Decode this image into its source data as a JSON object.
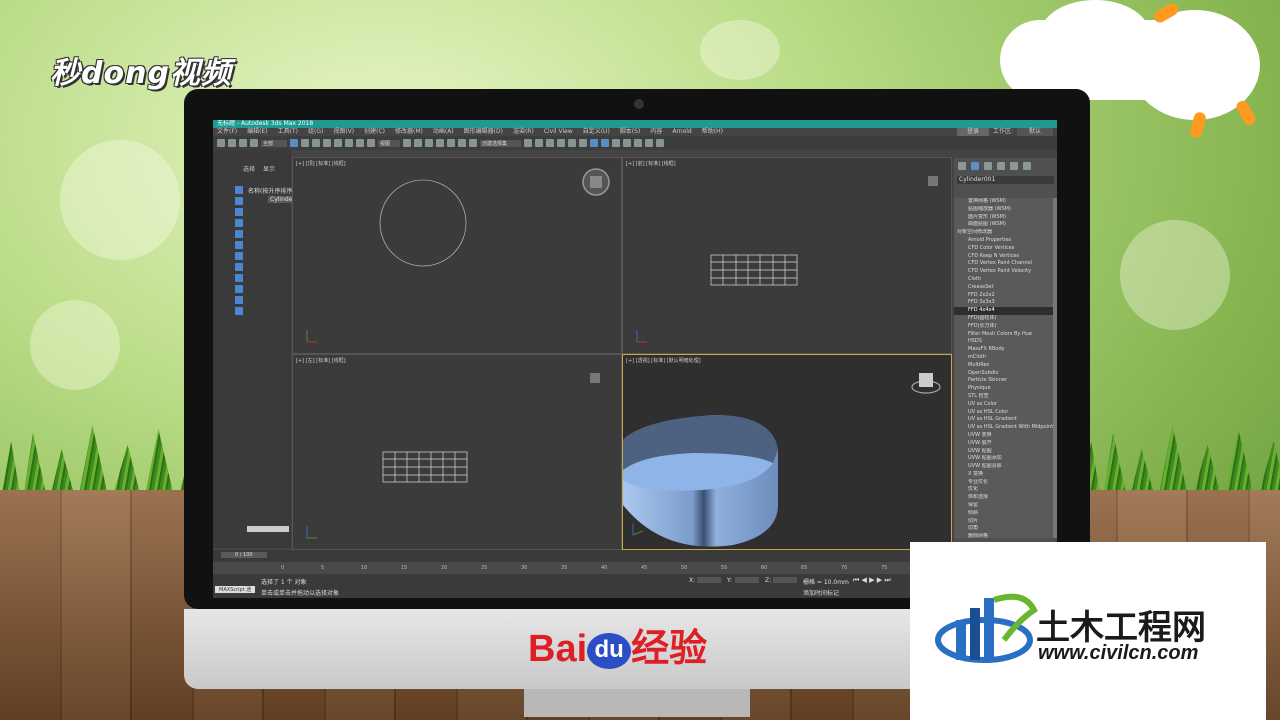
{
  "watermarks": {
    "top_logo": "秒dong视频",
    "baidu": {
      "bai": "Bai",
      "du": "du",
      "jingyan": "经验"
    },
    "civilcn": {
      "title": "土木工程网",
      "url": "www.civilcn.com"
    }
  },
  "app": {
    "title": "无标题 - Autodesk 3ds Max 2018",
    "menu": [
      "文件(F)",
      "编辑(E)",
      "工具(T)",
      "组(G)",
      "视图(V)",
      "创建(C)",
      "修改器(M)",
      "动画(A)",
      "图形编辑器(D)",
      "渲染(R)",
      "Civil View",
      "自定义(U)",
      "脚本(S)",
      "内容",
      "Arnold",
      "帮助(H)"
    ],
    "workspace_label": "工作区:",
    "workspace_value": "默认",
    "login": "登录",
    "selection_filter": "全部",
    "view_dropdown": "视图",
    "selection_set": "创建选择集"
  },
  "scene_explorer": {
    "tabs": [
      "选择",
      "显示"
    ],
    "column_header": "名称(按升序排序)",
    "item": "Cylinder"
  },
  "viewports": [
    {
      "label": "[+] [顶] [标准] [线框]"
    },
    {
      "label": "[+] [前] [标准] [线框]"
    },
    {
      "label": "[+] [左] [标准] [线框]"
    },
    {
      "label": "[+] [透视] [标准] [默认明暗处理]"
    }
  ],
  "command_panel": {
    "object_name": "Cylinder001",
    "items": [
      {
        "text": "置换网格 (WSM)",
        "type": "item"
      },
      {
        "text": "贴图缩放器 (WSM)",
        "type": "item"
      },
      {
        "text": "面片变形 (WSM)",
        "type": "item"
      },
      {
        "text": "曲面贴图 (WSM)",
        "type": "item"
      },
      {
        "text": "对象空间修改器",
        "type": "cat"
      },
      {
        "text": "Arnold Properties",
        "type": "item"
      },
      {
        "text": "CFD Color Vertices",
        "type": "item"
      },
      {
        "text": "CFD Keep N Vertices",
        "type": "item"
      },
      {
        "text": "CFD Vertex Paint Channel",
        "type": "item"
      },
      {
        "text": "CFD Vertex Paint Velocity",
        "type": "item"
      },
      {
        "text": "Cloth",
        "type": "item"
      },
      {
        "text": "CreaseSet",
        "type": "item"
      },
      {
        "text": "FFD 2x2x2",
        "type": "item"
      },
      {
        "text": "FFD 3x3x3",
        "type": "item"
      },
      {
        "text": "FFD 4x4x4",
        "type": "sel"
      },
      {
        "text": "FFD(圆柱体)",
        "type": "item"
      },
      {
        "text": "FFD(长方体)",
        "type": "item"
      },
      {
        "text": "Filter Mesh Colors By Hue",
        "type": "item"
      },
      {
        "text": "HSDS",
        "type": "item"
      },
      {
        "text": "MassFX RBody",
        "type": "item"
      },
      {
        "text": "mCloth",
        "type": "item"
      },
      {
        "text": "MultiRes",
        "type": "item"
      },
      {
        "text": "OpenSubdiv",
        "type": "item"
      },
      {
        "text": "Particle Skinner",
        "type": "item"
      },
      {
        "text": "Physique",
        "type": "item"
      },
      {
        "text": "STL 检查",
        "type": "item"
      },
      {
        "text": "UV as Color",
        "type": "item"
      },
      {
        "text": "UV as HSL Color",
        "type": "item"
      },
      {
        "text": "UV as HSL Gradient",
        "type": "item"
      },
      {
        "text": "UV as HSL Gradient With Midpoint",
        "type": "item"
      },
      {
        "text": "UVW 变换",
        "type": "item"
      },
      {
        "text": "UVW 展开",
        "type": "item"
      },
      {
        "text": "UVW 贴图",
        "type": "item"
      },
      {
        "text": "UVW 贴图添加",
        "type": "item"
      },
      {
        "text": "UVW 贴图清除",
        "type": "item"
      },
      {
        "text": "X 变换",
        "type": "item"
      },
      {
        "text": "专业优化",
        "type": "item"
      },
      {
        "text": "优化",
        "type": "item"
      },
      {
        "text": "体积选择",
        "type": "item"
      },
      {
        "text": "保留",
        "type": "item"
      },
      {
        "text": "倾斜",
        "type": "item"
      },
      {
        "text": "切片",
        "type": "item"
      },
      {
        "text": "切角",
        "type": "item"
      },
      {
        "text": "删除网格",
        "type": "item"
      }
    ]
  },
  "timeline": {
    "frame": "0 / 100",
    "ticks": [
      "0",
      "5",
      "10",
      "15",
      "20",
      "25",
      "30",
      "35",
      "40",
      "45",
      "50",
      "55",
      "60",
      "65",
      "70",
      "75",
      "80",
      "85",
      "90"
    ]
  },
  "status": {
    "maxscript": "MAXScript 迷",
    "selection": "选择了 1 个 对象",
    "prompt": "单击或单击并拖动以选择对象",
    "x_label": "X:",
    "y_label": "Y:",
    "z_label": "Z:",
    "grid": "栅格 = 10.0mm",
    "autokey": "添加时间标记"
  }
}
